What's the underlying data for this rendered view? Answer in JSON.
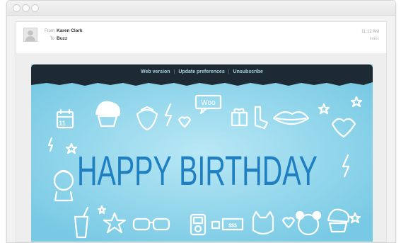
{
  "window": {
    "buttons": [
      "close",
      "minimize",
      "zoom"
    ]
  },
  "message": {
    "from_label": "From",
    "from": "Karen Clark",
    "to_label": "To",
    "to": "Buzz",
    "time": "11:12 AM",
    "folder": "Inbox"
  },
  "email": {
    "links": {
      "web_version": "Web version",
      "update_preferences": "Update preferences",
      "unsubscribe": "Unsubscribe",
      "separator": "|"
    },
    "banner": {
      "headline": "HAPPY BIRTHDAY",
      "sticker_text": "Woo",
      "calendar_day": "11",
      "ticket_text": "$$$",
      "background_color": "#8fd5ea",
      "headline_color": "#1f7fc0"
    }
  }
}
